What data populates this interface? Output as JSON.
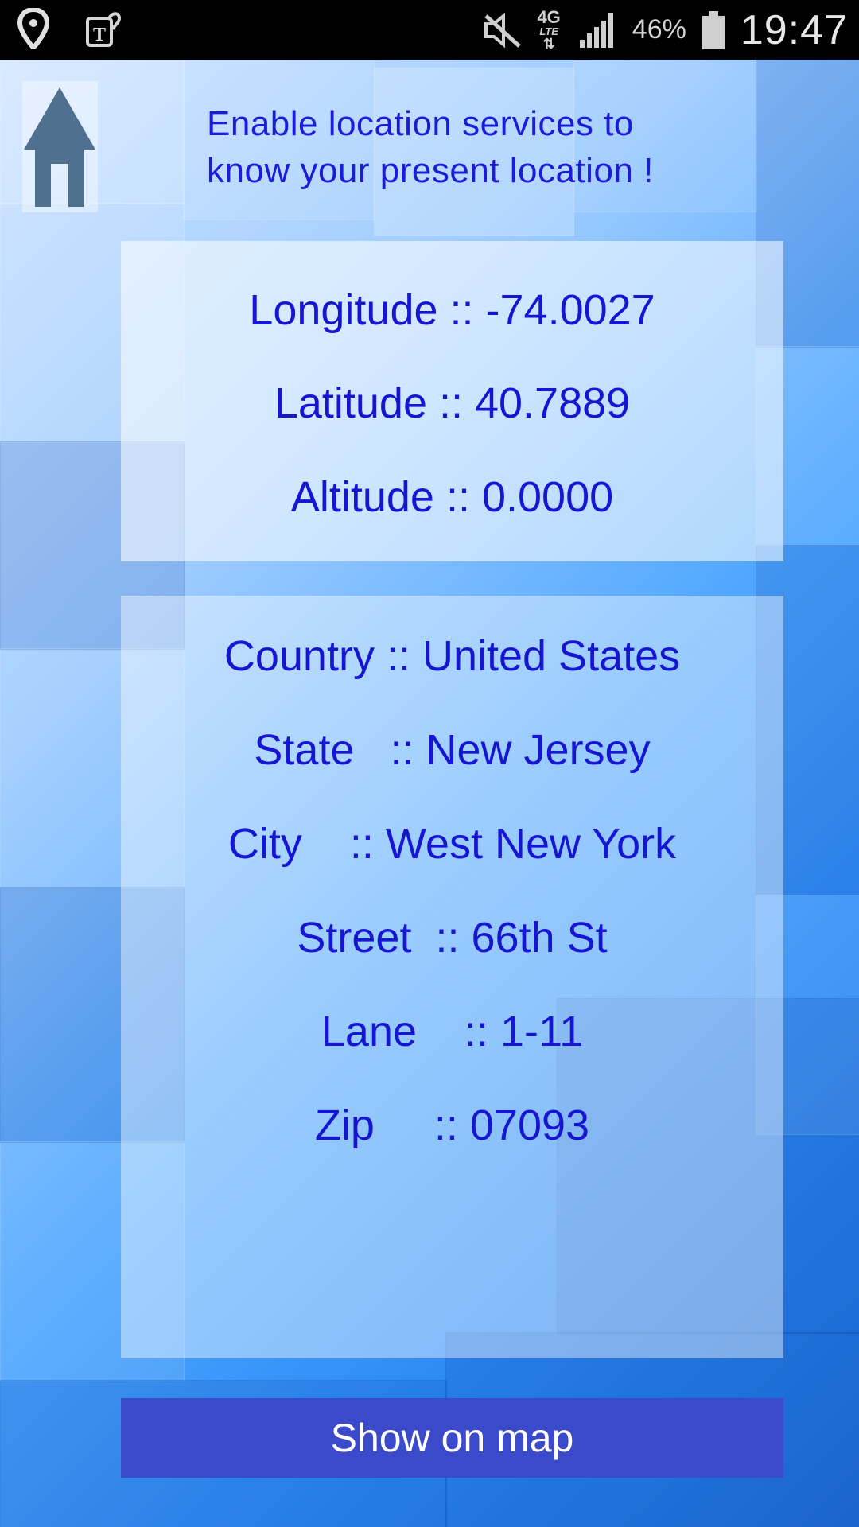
{
  "status_bar": {
    "icons": [
      "location-pin-icon",
      "t-mobile-tag-icon",
      "mute-icon",
      "signal-4g-lte-icon",
      "signal-bars-icon",
      "battery-icon"
    ],
    "network_type": "4G",
    "network_sub": "LTE",
    "battery_percent": "46%",
    "time": "19:47"
  },
  "home_button": {
    "icon": "home-icon"
  },
  "header": {
    "line1": "Enable location services to",
    "line2": "know your present location !"
  },
  "coordinates": {
    "longitude": "Longitude :: -74.0027",
    "latitude": "Latitude :: 40.7889",
    "altitude": "Altitude :: 0.0000"
  },
  "address": {
    "country": "Country :: United States",
    "state": "State   :: New Jersey",
    "city": "City    :: West New York",
    "street": "Street  :: 66th St",
    "lane": "Lane    :: 1-11",
    "zip": "Zip     :: 07093"
  },
  "map_button": {
    "label": "Show on map"
  },
  "colors": {
    "text_blue": "#1616d2",
    "button_bg": "#3a4acb",
    "status_bar_bg": "#000000"
  }
}
